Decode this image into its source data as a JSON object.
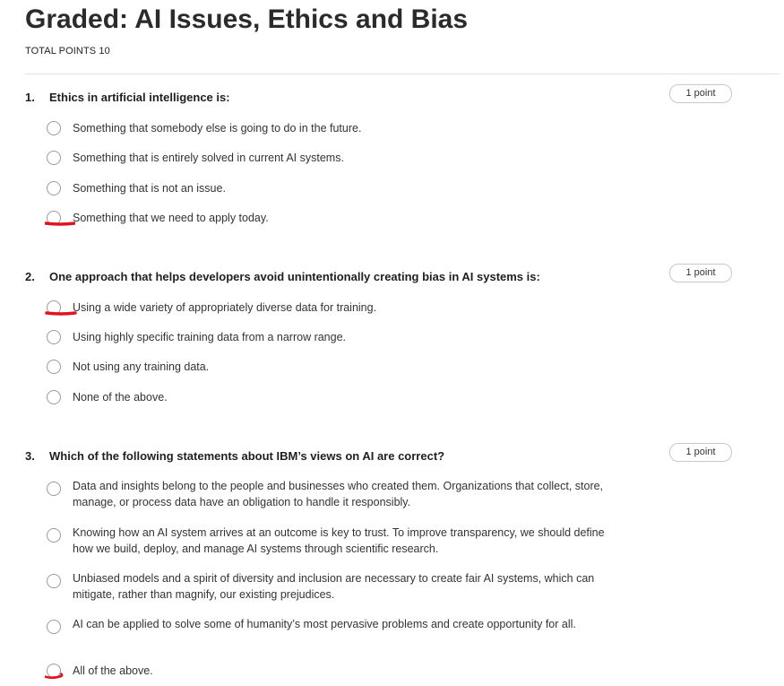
{
  "page": {
    "title": "Graded: AI Issues, Ethics and Bias",
    "total_points": "TOTAL POINTS 10"
  },
  "questions": [
    {
      "number": "1.",
      "text": "Ethics in artificial intelligence is:",
      "points": "1 point",
      "options": [
        {
          "label": "Something that somebody else is going to do in the future.",
          "marked": false
        },
        {
          "label": "Something that is entirely solved in current AI systems.",
          "marked": false
        },
        {
          "label": "Something that is not an issue.",
          "marked": false
        },
        {
          "label": "Something that we need to apply today.",
          "marked": true
        }
      ]
    },
    {
      "number": "2.",
      "text": "One approach that helps developers avoid unintentionally creating bias in AI systems is:",
      "points": "1 point",
      "options": [
        {
          "label": "Using a wide variety of appropriately diverse data for training.",
          "marked": true
        },
        {
          "label": "Using highly specific training data from a narrow range.",
          "marked": false
        },
        {
          "label": "Not using any training data.",
          "marked": false
        },
        {
          "label": "None of the above.",
          "marked": false
        }
      ]
    },
    {
      "number": "3.",
      "text": "Which of the following statements about IBM’s views on AI are correct?",
      "points": "1 point",
      "options": [
        {
          "label": "Data and insights belong to the people and businesses who created them. Organizations that collect, store, manage, or process data have an obligation to handle it responsibly.",
          "marked": false
        },
        {
          "label": "Knowing how an AI system arrives at an outcome is key to trust. To improve transparency, we should define how we build, deploy, and manage AI systems through scientific research.",
          "marked": false
        },
        {
          "label": "Unbiased models and a spirit of diversity and inclusion are necessary to create fair AI systems, which can mitigate, rather than magnify, our existing prejudices.",
          "marked": false
        },
        {
          "label": "AI can be applied to solve some of humanity’s most pervasive problems and create opportunity for all.",
          "marked": false
        },
        {
          "label": "All of the above.",
          "marked": true
        }
      ]
    }
  ],
  "colors": {
    "annotation_mark": "#e0141e",
    "radio_border": "#9a9a9a"
  }
}
